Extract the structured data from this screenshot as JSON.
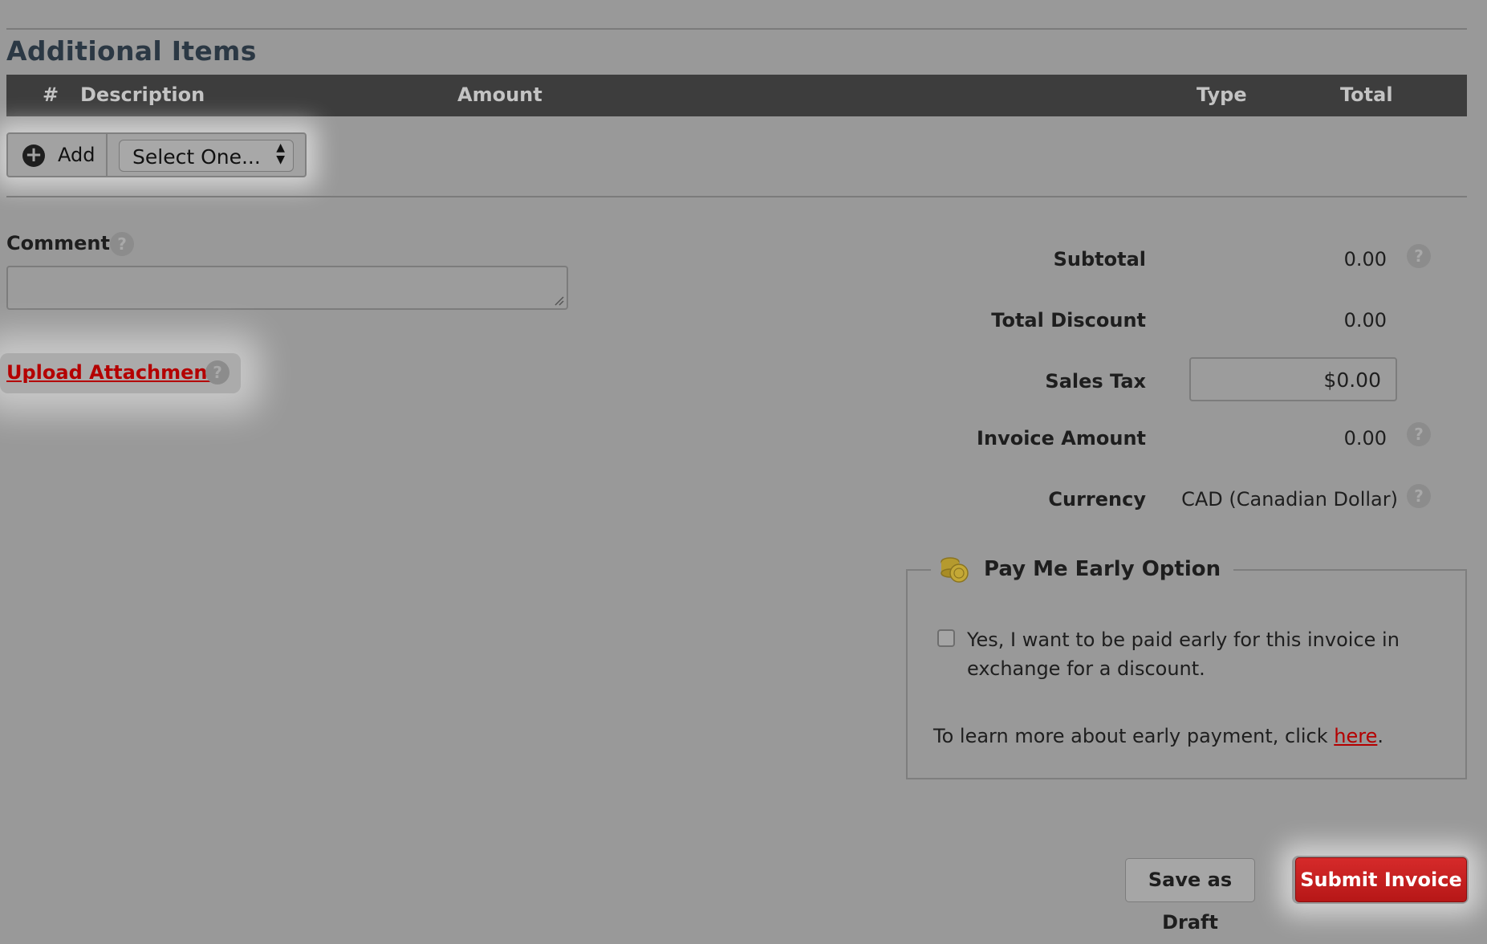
{
  "section": {
    "title": "Additional Items"
  },
  "table": {
    "headers": {
      "num": "#",
      "description": "Description",
      "amount": "Amount",
      "type": "Type",
      "total": "Total"
    }
  },
  "add_group": {
    "add_label": "Add",
    "select_value": "Select One..."
  },
  "comment": {
    "label": "Comment",
    "value": ""
  },
  "upload": {
    "label": "Upload Attachment"
  },
  "summary": {
    "subtotal_label": "Subtotal",
    "subtotal_value": "0.00",
    "discount_label": "Total Discount",
    "discount_value": "0.00",
    "tax_label": "Sales Tax",
    "tax_value": "$0.00",
    "invoice_label": "Invoice Amount",
    "invoice_value": "0.00",
    "currency_label": "Currency",
    "currency_value": "CAD (Canadian Dollar)"
  },
  "early": {
    "title": "Pay Me Early Option",
    "checkbox_label": "Yes, I want to be paid early for this invoice in exchange for a discount.",
    "checked": false,
    "learn_prefix": "To learn more about early payment, click ",
    "learn_link": "here",
    "learn_suffix": "."
  },
  "actions": {
    "draft_label": "Save as Draft",
    "submit_label": "Submit Invoice"
  },
  "colors": {
    "link_red": "#b40000",
    "submit_red": "#c62020",
    "header_bg": "#3d3d3d",
    "overlay_bg": "#999999"
  }
}
